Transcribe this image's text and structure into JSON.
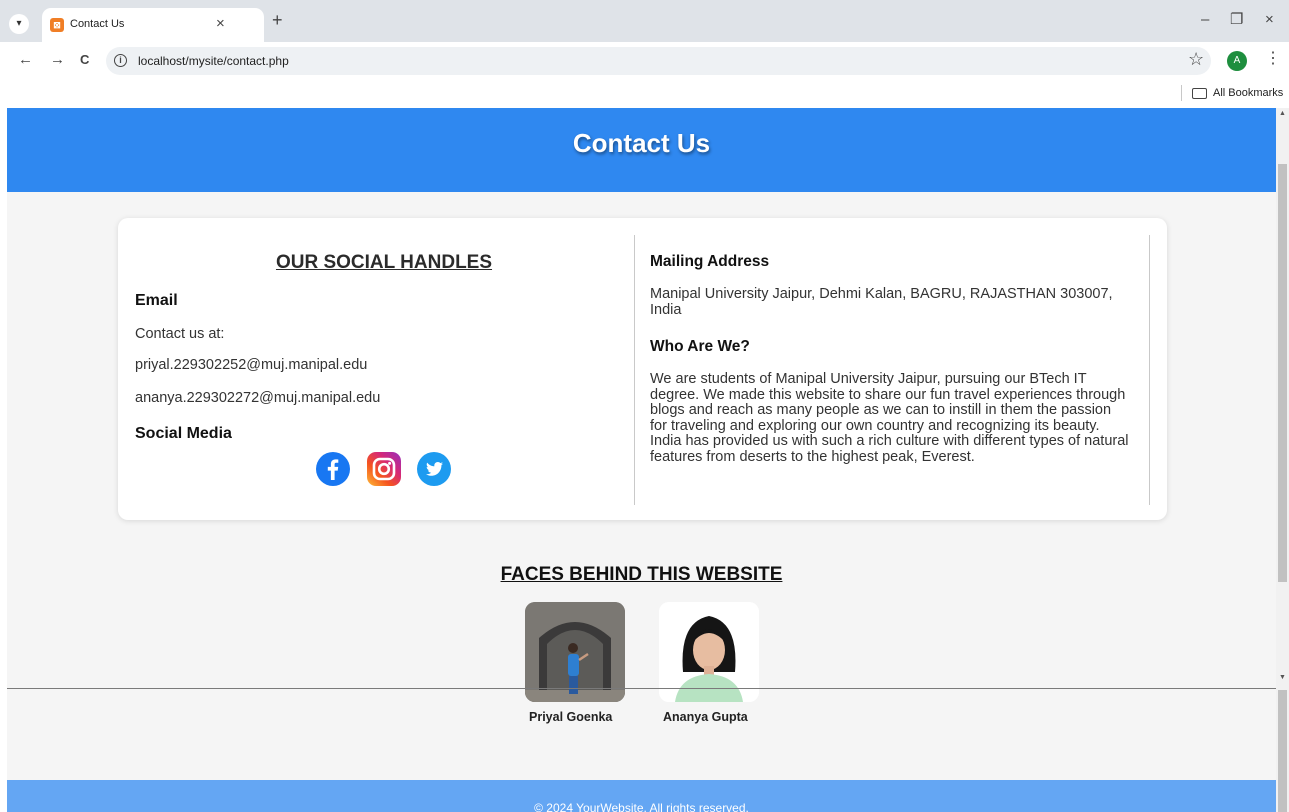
{
  "browser": {
    "tab_title": "Contact Us",
    "tab_favicon": "xampp-icon",
    "tab_close": "×",
    "new_tab": "+",
    "url": "localhost/mysite/contact.php",
    "profile_initial": "A",
    "bookmarks_label": "All Bookmarks",
    "win_minimize": "–",
    "win_restore": "❐",
    "win_close": "×",
    "back": "←",
    "forward": "→",
    "reload": "C",
    "star": "☆",
    "menu": "⋮"
  },
  "header": {
    "title": "Contact Us"
  },
  "social": {
    "heading": "OUR SOCIAL HANDLES",
    "email_label": "Email",
    "contact_text": "Contact us at:",
    "emails": [
      "priyal.229302252@muj.manipal.edu",
      "ananya.229302272@muj.manipal.edu"
    ],
    "media_label": "Social Media",
    "icons": [
      "facebook-icon",
      "instagram-icon",
      "twitter-icon"
    ]
  },
  "about": {
    "mailing_label": "Mailing Address",
    "address_line1": "Manipal University Jaipur, Dehmi Kalan, BAGRU, RAJASTHAN 303007,",
    "address_line2": "India",
    "who_label": "Who Are We?",
    "who_lines": [
      "We are students of Manipal University Jaipur, pursuing our BTech IT",
      "degree. We made this website to share our fun travel experiences through",
      "blogs and reach as many people as we can to instill in them the passion",
      "for traveling and exploring our own country and recognizing its beauty.",
      "India has provided us with such a rich culture with different types of natural",
      "features from deserts to the highest peak, Everest."
    ]
  },
  "faces": {
    "heading": "FACES BEHIND THIS WEBSITE",
    "people": [
      {
        "name": "Priyal Goenka"
      },
      {
        "name": "Ananya Gupta"
      }
    ]
  },
  "footer": {
    "text": "© 2024 YourWebsite. All rights reserved."
  },
  "colors": {
    "header": "#2f88f0",
    "footer": "#64a6f3",
    "page_bg": "#f5f5f5"
  }
}
